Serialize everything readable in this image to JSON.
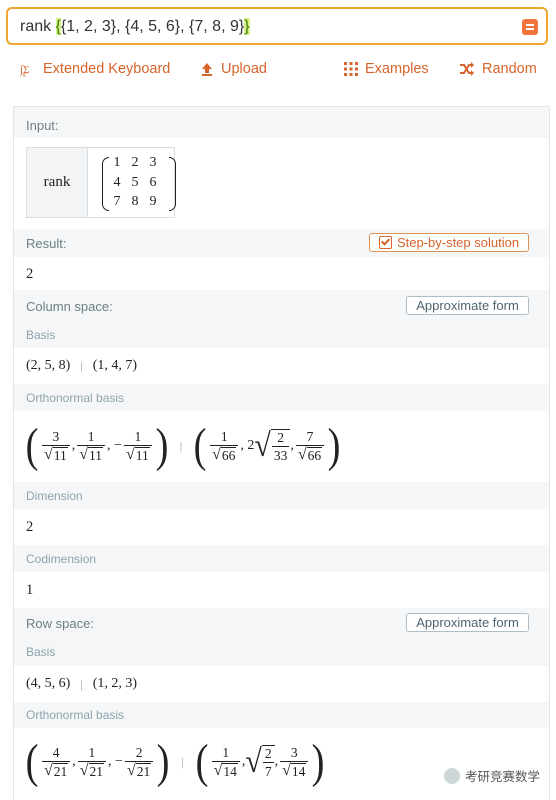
{
  "search": {
    "prefix": "rank ",
    "open": "{",
    "body": "{1, 2, 3}, {4, 5, 6}, {7, 8, 9}",
    "close": "}",
    "go_icon": "equals-icon"
  },
  "toolbar": {
    "keyboard": "Extended Keyboard",
    "upload": "Upload",
    "examples": "Examples",
    "random": "Random"
  },
  "input": {
    "label": "Input:",
    "func": "rank",
    "matrix": [
      [
        "1",
        "2",
        "3"
      ],
      [
        "4",
        "5",
        "6"
      ],
      [
        "7",
        "8",
        "9"
      ]
    ]
  },
  "result": {
    "label": "Result:",
    "step_button": "Step-by-step solution",
    "value": "2"
  },
  "column_space": {
    "label": "Column space:",
    "approx_button": "Approximate form",
    "basis_label": "Basis",
    "basis_a": "(2, 5, 8)",
    "basis_b": "(1, 4, 7)",
    "ortho_label": "Orthonormal basis",
    "dimension_label": "Dimension",
    "dimension": "2",
    "codimension_label": "Codimension",
    "codimension": "1"
  },
  "row_space": {
    "label": "Row space:",
    "approx_button": "Approximate form",
    "basis_label": "Basis",
    "basis_a": "(4, 5, 6)",
    "basis_b": "(1, 2, 3)",
    "ortho_label": "Orthonormal basis"
  },
  "separator": "|",
  "watermark": "考研竞赛数学"
}
